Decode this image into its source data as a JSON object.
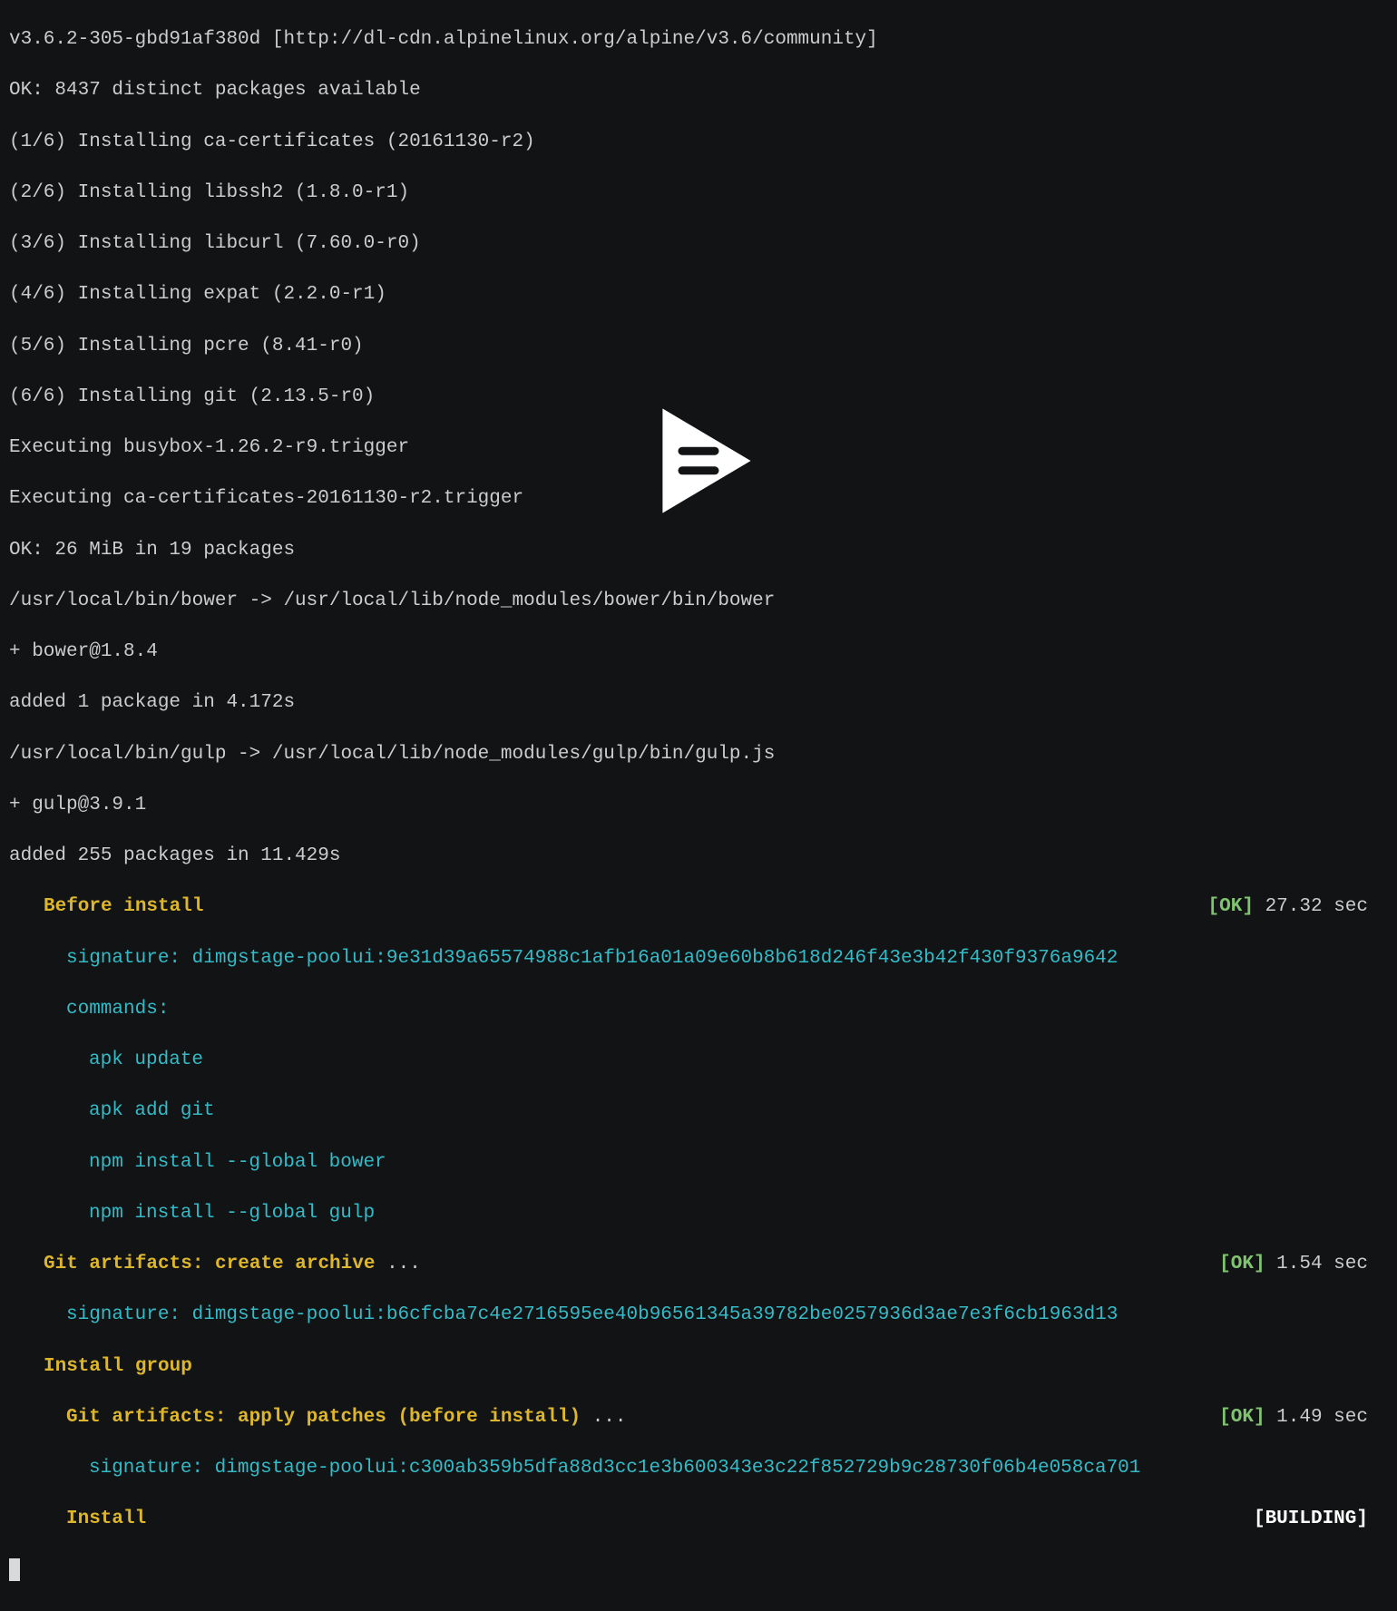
{
  "output": {
    "lines": [
      "v3.6.2-305-gbd91af380d [http://dl-cdn.alpinelinux.org/alpine/v3.6/community]",
      "OK: 8437 distinct packages available",
      "(1/6) Installing ca-certificates (20161130-r2)",
      "(2/6) Installing libssh2 (1.8.0-r1)",
      "(3/6) Installing libcurl (7.60.0-r0)",
      "(4/6) Installing expat (2.2.0-r1)",
      "(5/6) Installing pcre (8.41-r0)",
      "(6/6) Installing git (2.13.5-r0)",
      "Executing busybox-1.26.2-r9.trigger",
      "Executing ca-certificates-20161130-r2.trigger",
      "OK: 26 MiB in 19 packages",
      "/usr/local/bin/bower -> /usr/local/lib/node_modules/bower/bin/bower",
      "+ bower@1.8.4",
      "added 1 package in 4.172s",
      "/usr/local/bin/gulp -> /usr/local/lib/node_modules/gulp/bin/gulp.js",
      "+ gulp@3.9.1",
      "added 255 packages in 11.429s"
    ]
  },
  "stages": {
    "before_install": {
      "label": "Before install",
      "status": "[OK]",
      "time": "27.32 sec",
      "signature_label": "signature: ",
      "signature_value": "dimgstage-poolui:9e31d39a65574988c1afb16a01a09e60b8b618d246f43e3b42f430f9376a9642",
      "commands_label": "commands:",
      "commands": [
        "apk update",
        "apk add git",
        "npm install --global bower",
        "npm install --global gulp"
      ]
    },
    "git_artifacts_create": {
      "label": "Git artifacts: create archive",
      "ellipsis": " ...",
      "status": "[OK]",
      "time": "1.54 sec",
      "signature_label": "signature: ",
      "signature_value": "dimgstage-poolui:b6cfcba7c4e2716595ee40b96561345a39782be0257936d3ae7e3f6cb1963d13"
    },
    "install_group": {
      "label": "Install group"
    },
    "git_artifacts_apply": {
      "label": "Git artifacts: apply patches (before install)",
      "ellipsis": " ...",
      "status": "[OK]",
      "time": "1.49 sec",
      "signature_label": "signature: ",
      "signature_value": "dimgstage-poolui:c300ab359b5dfa88d3cc1e3b600343e3c22f852729b9c28730f06b4e058ca701"
    },
    "install": {
      "label": "Install",
      "status": "[BUILDING]"
    }
  }
}
